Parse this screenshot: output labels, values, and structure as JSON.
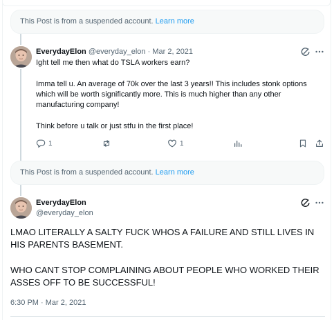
{
  "suspended_notice_1": {
    "text": "This Post is from a suspended account.",
    "link": "Learn more"
  },
  "reply_tweet": {
    "author": {
      "name": "EverydayElon",
      "handle": "@everyday_elon",
      "separator": "·",
      "date": "Mar 2, 2021"
    },
    "lines": [
      "Ight tell me then what do TSLA workers earn?",
      "Imma tell u. An average of 70k over the last 3 years!! This includes stonk options which will be worth significantly more. This is much higher than any other manufacturing company!",
      "Think before u talk or just stfu in the first place!"
    ],
    "actions": {
      "reply_count": "1",
      "like_count": "1"
    }
  },
  "suspended_notice_2": {
    "text": "This Post is from a suspended account.",
    "link": "Learn more"
  },
  "main_tweet": {
    "author": {
      "name": "EverydayElon",
      "handle": "@everyday_elon"
    },
    "paragraphs": [
      "LMAO LITERALLY A SALTY FUCK WHOS A FAILURE AND STILL LIVES IN HIS PARENTS BASEMENT.",
      "WHO CANT STOP COMPLAINING ABOUT PEOPLE WHO WORKED THEIR ASSES OFF TO BE SUCCESSFUL!"
    ],
    "timestamp": "6:30 PM · Mar 2, 2021"
  },
  "icons": {
    "grok": "grok-icon",
    "more": "more-icon",
    "reply": "reply-icon",
    "repost": "repost-icon",
    "like": "like-icon",
    "views": "views-icon",
    "bookmark": "bookmark-icon",
    "share": "share-icon"
  },
  "colors": {
    "link": "#1d9bf0",
    "muted": "#536471",
    "text": "#0f1419",
    "notice_bg": "#f7f9f9"
  }
}
